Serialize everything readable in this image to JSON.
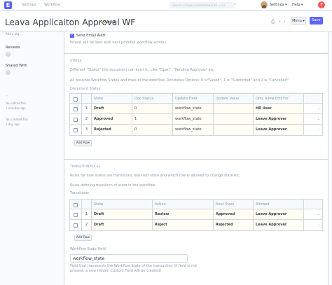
{
  "navbar": {
    "logo": "E",
    "breadcrumbs": [
      "Settings",
      "Workflow"
    ],
    "search_placeholder": "Search or type a command (Ctrl + G)",
    "settings_label": "Settings",
    "help_label": "Help",
    "notification_count": "7"
  },
  "titlebar": {
    "title": "Leava Applicaiton Approval WF",
    "status": "Active",
    "menu_label": "Menu",
    "save_label": "Save"
  },
  "sidebar": {
    "tags_add": "Add a tag ...",
    "reviews_label": "Reviews",
    "shared_label": "Shared With",
    "edited_line1": "You edited this",
    "edited_line2": "2 minutes ago",
    "created_line1": "You created this",
    "created_line2": "a day ago"
  },
  "form": {
    "send_email_label": "Send Email Alert",
    "send_email_checked": true,
    "send_email_desc": "Emails will be sent with next possible workflow actions",
    "states_heading": "STATES",
    "states_desc1": "Different \"States\" this document can exist in. Like \"Open\", \"Pending Approval\" etc.",
    "states_desc2": "All possible Workflow States and roles of the workflow. Docstatus Options: 0 is\"Saved\", 1 is \"Submitted\" and 2 is \"Cancelled\"",
    "states_table_label": "Document States",
    "states_columns": [
      "",
      "",
      "State",
      "Doc Status",
      "Update Field",
      "Update Value",
      "Only Allow Edit For",
      ""
    ],
    "states_rows": [
      {
        "idx": "1",
        "state": "Draft",
        "doc_status": "0",
        "update_field": "workflow_state",
        "update_value": "",
        "role": "HR User"
      },
      {
        "idx": "2",
        "state": "Approved",
        "doc_status": "1",
        "update_field": "workflow_state",
        "update_value": "",
        "role": "Leave Approver"
      },
      {
        "idx": "3",
        "state": "Rejected",
        "doc_status": "0",
        "update_field": "workflow_state",
        "update_value": "",
        "role": "Leave Approver"
      }
    ],
    "add_row_label": "Add Row",
    "transition_heading": "TRANSITION RULES",
    "transition_desc1": "Rules for how states are transitions, like next state and which role is allowed to change state etc.",
    "transition_desc2": "Rules defining transition of state in the workflow.",
    "transitions_table_label": "Transitions",
    "transition_columns": [
      "",
      "",
      "State",
      "Action",
      "Next State",
      "Allowed",
      ""
    ],
    "transition_rows": [
      {
        "idx": "1",
        "state": "Draft",
        "action": "Review",
        "next_state": "Approved",
        "allowed": "Leave Approver"
      },
      {
        "idx": "2",
        "state": "Draft",
        "action": "Reject",
        "next_state": "Rejected",
        "allowed": "Leave Approver"
      }
    ],
    "ws_field_label": "Workflow State Field",
    "ws_field_value": "workflow_state",
    "ws_field_desc1": "Field that represents the Workflow State of the transaction (if field is not",
    "ws_field_desc2": "present, a new hidden Custom Field will be created)"
  }
}
